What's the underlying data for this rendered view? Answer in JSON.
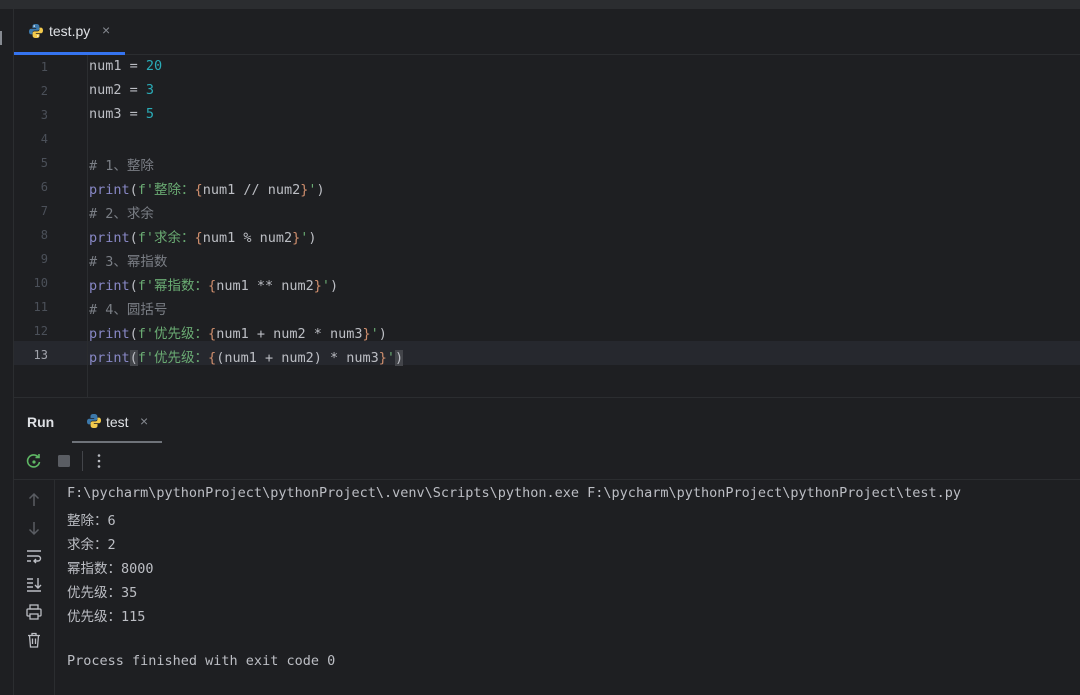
{
  "editor": {
    "tab": {
      "filename": "test.py"
    },
    "lines": [
      {
        "n": "1"
      },
      {
        "n": "2"
      },
      {
        "n": "3"
      },
      {
        "n": "4"
      },
      {
        "n": "5"
      },
      {
        "n": "6"
      },
      {
        "n": "7"
      },
      {
        "n": "8"
      },
      {
        "n": "9"
      },
      {
        "n": "10"
      },
      {
        "n": "11"
      },
      {
        "n": "12"
      },
      {
        "n": "13"
      }
    ],
    "code": {
      "l1": {
        "var": "num1",
        "op": " = ",
        "val": "20"
      },
      "l2": {
        "var": "num2",
        "op": " = ",
        "val": "3"
      },
      "l3": {
        "var": "num3",
        "op": " = ",
        "val": "5"
      },
      "l5": "# 1、整除",
      "l6": {
        "fn": "print",
        "open": "(",
        "pre": "f'",
        "label": "整除：",
        "lb": "{",
        "expr": "num1 // num2",
        "rb": "}",
        "post": "'",
        "close": ")"
      },
      "l7": "# 2、求余",
      "l8": {
        "fn": "print",
        "open": "(",
        "pre": "f'",
        "label": "求余：",
        "lb": "{",
        "expr": "num1 % num2",
        "rb": "}",
        "post": "'",
        "close": ")"
      },
      "l9": "# 3、幂指数",
      "l10": {
        "fn": "print",
        "open": "(",
        "pre": "f'",
        "label": "幂指数：",
        "lb": "{",
        "expr": "num1 ** num2",
        "rb": "}",
        "post": "'",
        "close": ")"
      },
      "l11": "# 4、圆括号",
      "l12": {
        "fn": "print",
        "open": "(",
        "pre": "f'",
        "label": "优先级：",
        "lb": "{",
        "expr": "num1 + num2 * num3",
        "rb": "}",
        "post": "'",
        "close": ")"
      },
      "l13": {
        "fn": "print",
        "open": "(",
        "pre": "f'",
        "label": "优先级：",
        "lb": "{",
        "expr": "(num1 + num2) * num3",
        "rb": "}",
        "post": "'",
        "close": ")"
      }
    }
  },
  "run": {
    "title": "Run",
    "tab": "test",
    "output": [
      "F:\\pycharm\\pythonProject\\pythonProject\\.venv\\Scripts\\python.exe F:\\pycharm\\pythonProject\\pythonProject\\test.py",
      "整除：6",
      "求余：2",
      "幂指数：8000",
      "优先级：35",
      "优先级：115",
      "",
      "Process finished with exit code 0"
    ]
  },
  "colors": {
    "accent": "#3574f0",
    "background": "#1e1f22",
    "number": "#2aacb8",
    "string": "#6aab73",
    "keyword_fn": "#8888c6",
    "comment": "#7a7e85"
  },
  "icons": [
    "python-file-icon",
    "close-icon",
    "rerun-icon",
    "stop-icon",
    "more-options-icon",
    "scroll-up-icon",
    "scroll-down-icon",
    "soft-wrap-icon",
    "scroll-to-end-icon",
    "print-icon",
    "trash-icon"
  ]
}
